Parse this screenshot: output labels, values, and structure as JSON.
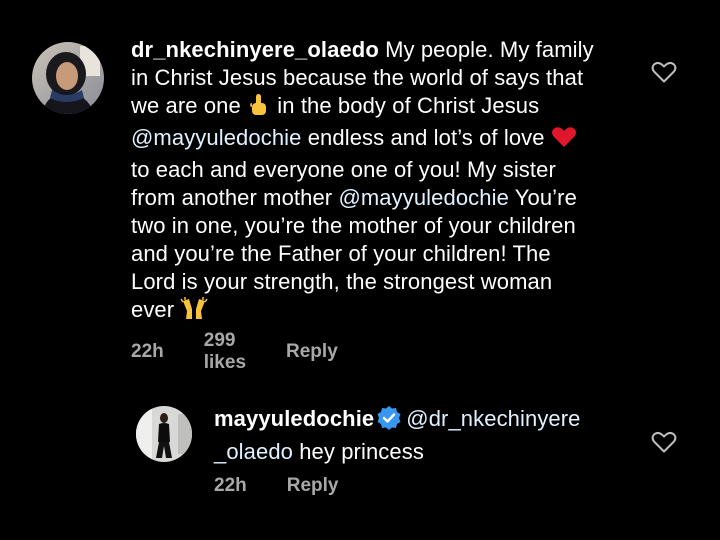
{
  "comment": {
    "username": "dr_nkechinyere_olaedo",
    "lines": [
      " My people. My family",
      "in Christ Jesus because the world of says that",
      "we are one ",
      " in the body of Christ Jesus",
      "@mayyuledochie",
      " endless and lot’s of love ",
      "to each and everyone one of you!  My sister",
      "from another mother ",
      "@mayyuledochie",
      " You’re",
      "two in one, you’re the mother of your children",
      "and you’re the Father of your children! The",
      "Lord is your strength, the strongest woman",
      "ever "
    ],
    "emojis": {
      "pointing_up": "index-pointing-up-emoji",
      "heart": "red-heart-emoji",
      "raised_hands": "raising-hands-emoji"
    },
    "time": "22h",
    "likes": "299 likes",
    "reply_label": "Reply",
    "like_icon": "heart-outline-icon"
  },
  "reply": {
    "username": "mayyuledochie",
    "verified_icon": "verified-badge-icon",
    "mention": "@dr_nkechinyere",
    "mention_cont": "_olaedo",
    "text": " hey princess",
    "time": "22h",
    "reply_label": "Reply",
    "like_icon": "heart-outline-icon"
  },
  "colors": {
    "background": "#000000",
    "text": "#ffffff",
    "mention": "#e0f1ff",
    "meta": "#a8a8a8",
    "verified": "#3897f0",
    "heart_emoji": "#e0162b"
  }
}
